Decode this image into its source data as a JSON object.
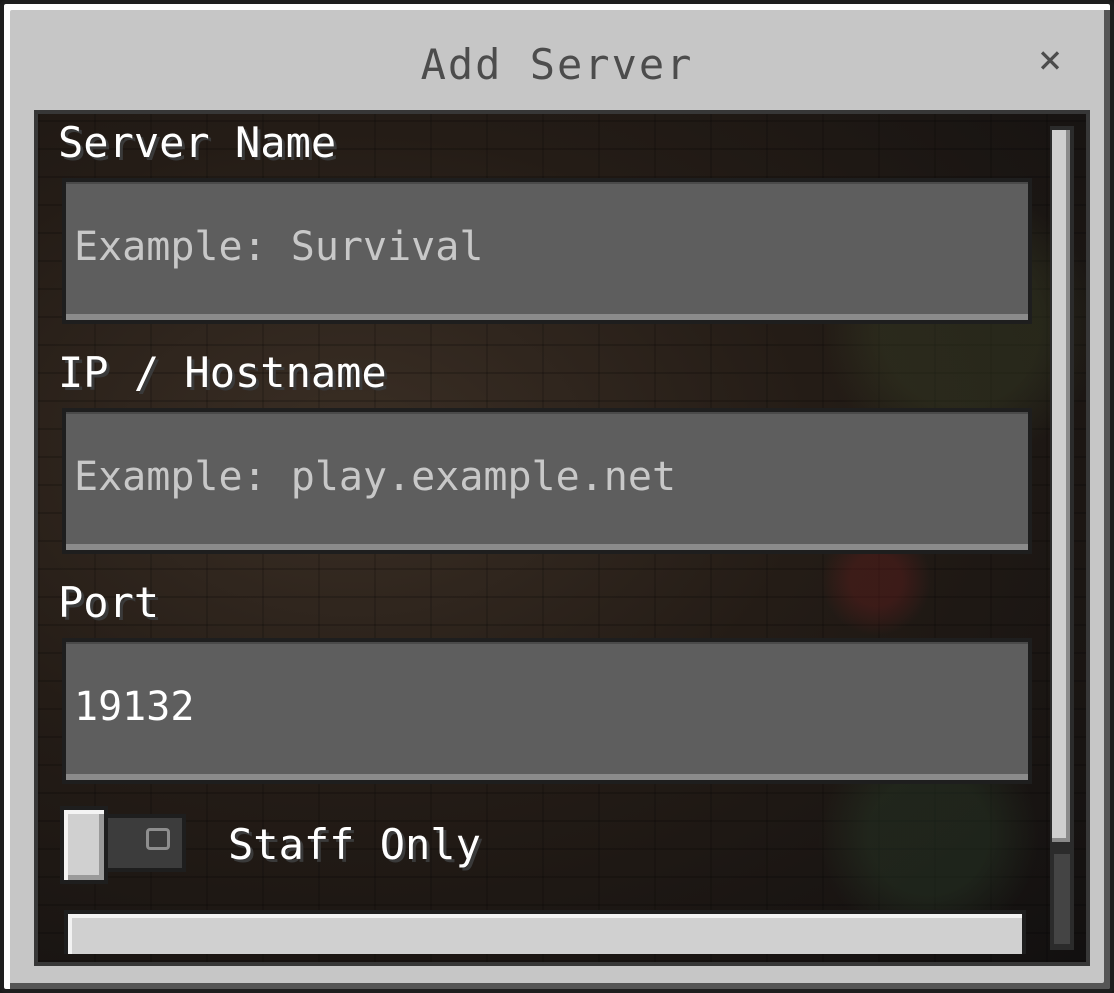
{
  "dialog": {
    "title": "Add Server",
    "close_glyph": "×"
  },
  "form": {
    "server_name": {
      "label": "Server Name",
      "value": "",
      "placeholder": "Example: Survival"
    },
    "hostname": {
      "label": "IP / Hostname",
      "value": "",
      "placeholder": "Example: play.example.net"
    },
    "port": {
      "label": "Port",
      "value": "19132",
      "placeholder": ""
    },
    "staff_only": {
      "label": "Staff Only",
      "checked": false
    }
  },
  "icons": {
    "close": "close-icon",
    "toggle_off_mark": "toggle-off-icon"
  },
  "colors": {
    "dialog_bg": "#c6c6c6",
    "title_text": "#4c4c4c",
    "field_bg": "#5e5e5e",
    "label_text": "#ffffff",
    "placeholder_text": "#c8c8c8"
  }
}
